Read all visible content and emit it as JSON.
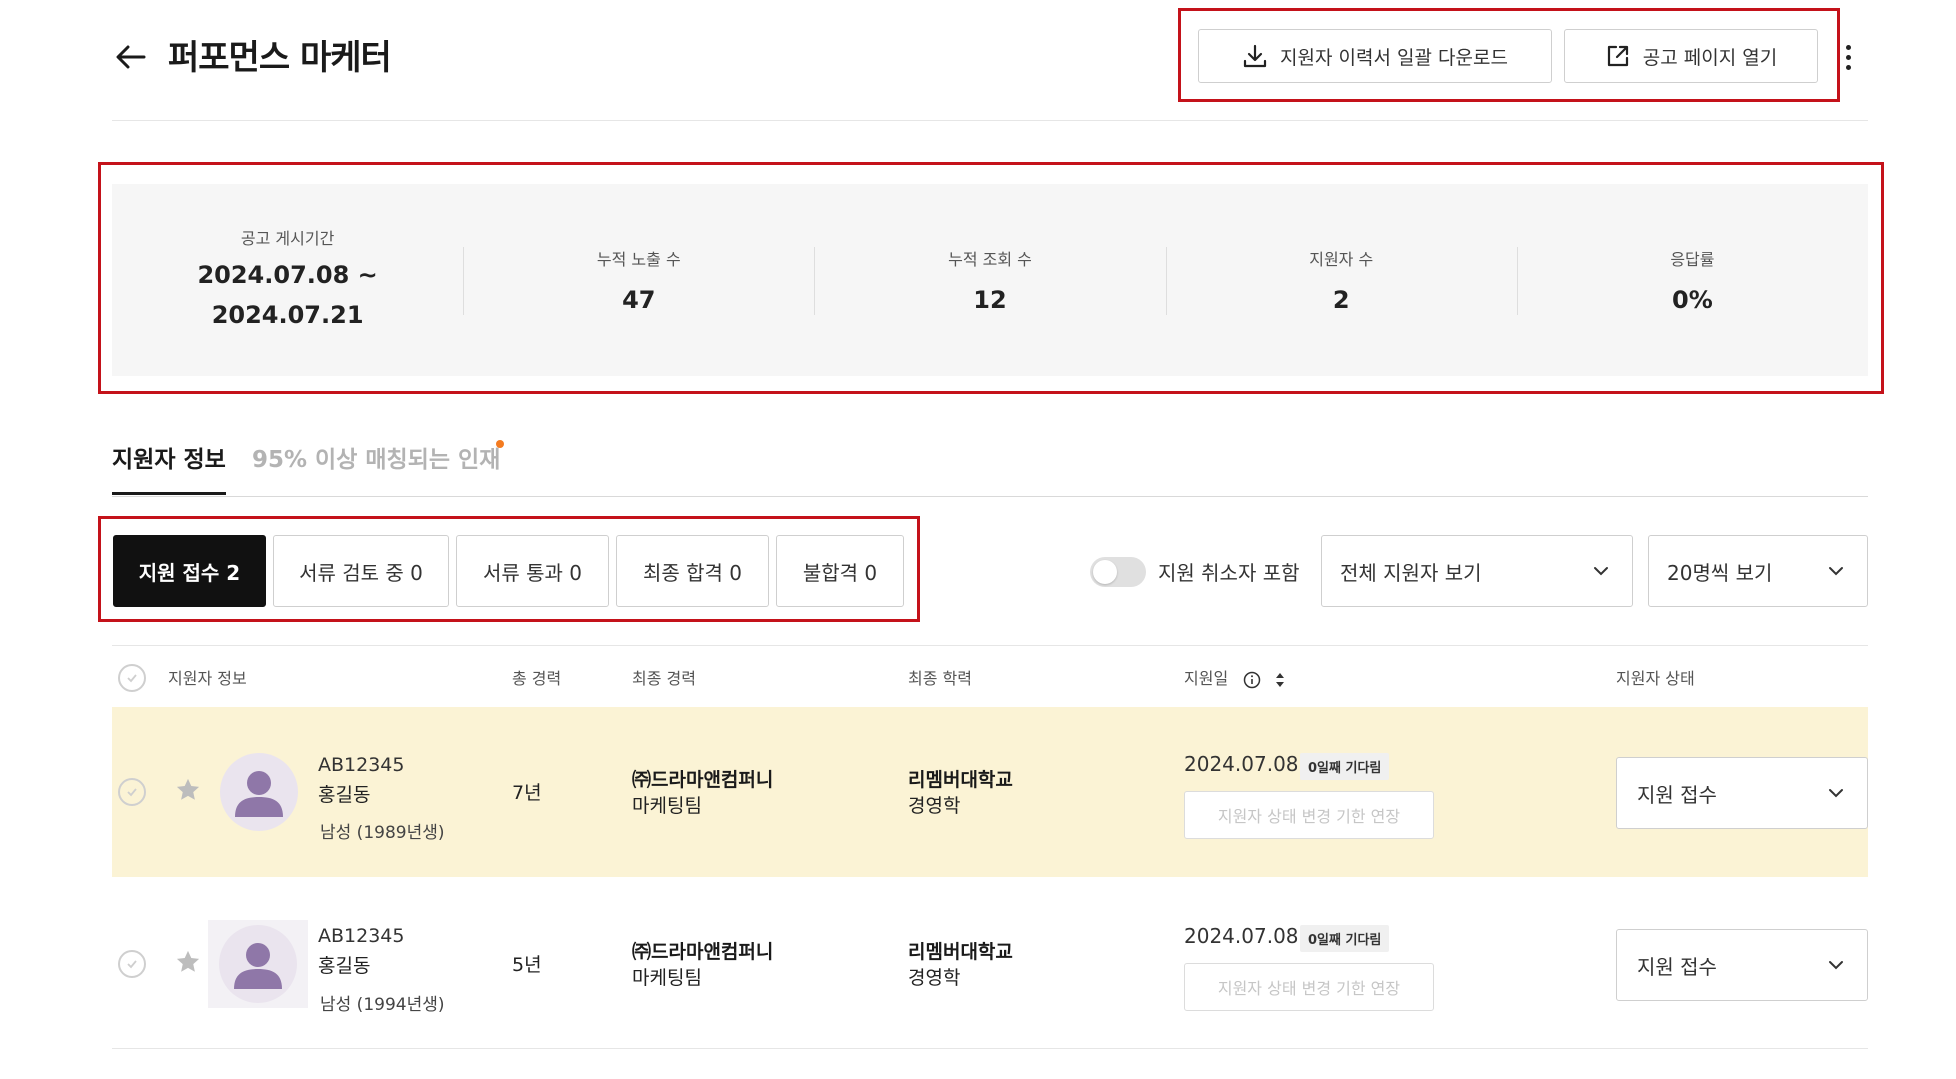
{
  "header": {
    "title": "퍼포먼스 마케터",
    "download_label": "지원자 이력서 일괄 다운로드",
    "open_label": "공고 페이지 열기"
  },
  "stats": {
    "period": {
      "label": "공고 게시기간",
      "start": "2024.07.08 ~",
      "end": "2024.07.21"
    },
    "impressions": {
      "label": "누적 노출 수",
      "value": "47"
    },
    "views": {
      "label": "누적 조회 수",
      "value": "12"
    },
    "applicants": {
      "label": "지원자 수",
      "value": "2"
    },
    "response_rate": {
      "label": "응답률",
      "value": "0%"
    }
  },
  "tabs": [
    {
      "label": "지원자 정보",
      "active": true
    },
    {
      "label": "95% 이상 매칭되는 인재",
      "active": false
    }
  ],
  "filters": [
    {
      "label": "지원 접수 2",
      "active": true
    },
    {
      "label": "서류 검토 중 0",
      "active": false
    },
    {
      "label": "서류 통과 0",
      "active": false
    },
    {
      "label": "최종 합격 0",
      "active": false
    },
    {
      "label": "불합격 0",
      "active": false
    }
  ],
  "toggle": {
    "label": "지원 취소자 포함",
    "on": false
  },
  "selects": {
    "view_all": "전체 지원자 보기",
    "per_page": "20명씩 보기"
  },
  "table": {
    "headers": {
      "info": "지원자 정보",
      "total_career": "총 경력",
      "last_career": "최종 경력",
      "last_edu": "최종 학력",
      "applied": "지원일",
      "status": "지원자 상태"
    },
    "rows": [
      {
        "id": "AB12345",
        "name": "홍길동",
        "gender": "남성 (1989년생)",
        "total_career": "7년",
        "company": "㈜드라마앤컴퍼니",
        "team": "마케팅팀",
        "school": "리멤버대학교",
        "major": "경영학",
        "date": "2024.07.08",
        "wait": "0일째 기다림",
        "extend": "지원자 상태 변경 기한 연장",
        "status": "지원 접수"
      },
      {
        "id": "AB12345",
        "name": "홍길동",
        "gender": "남성 (1994년생)",
        "total_career": "5년",
        "company": "㈜드라마앤컴퍼니",
        "team": "마케팅팀",
        "school": "리멤버대학교",
        "major": "경영학",
        "date": "2024.07.08",
        "wait": "0일째 기다림",
        "extend": "지원자 상태 변경 기한 연장",
        "status": "지원 접수"
      }
    ]
  },
  "colors": {
    "highlight_box": "#c4121a",
    "row_highlight": "#fbf3d5",
    "tab_dot": "#f47b20",
    "avatar": "#8f77a8"
  }
}
